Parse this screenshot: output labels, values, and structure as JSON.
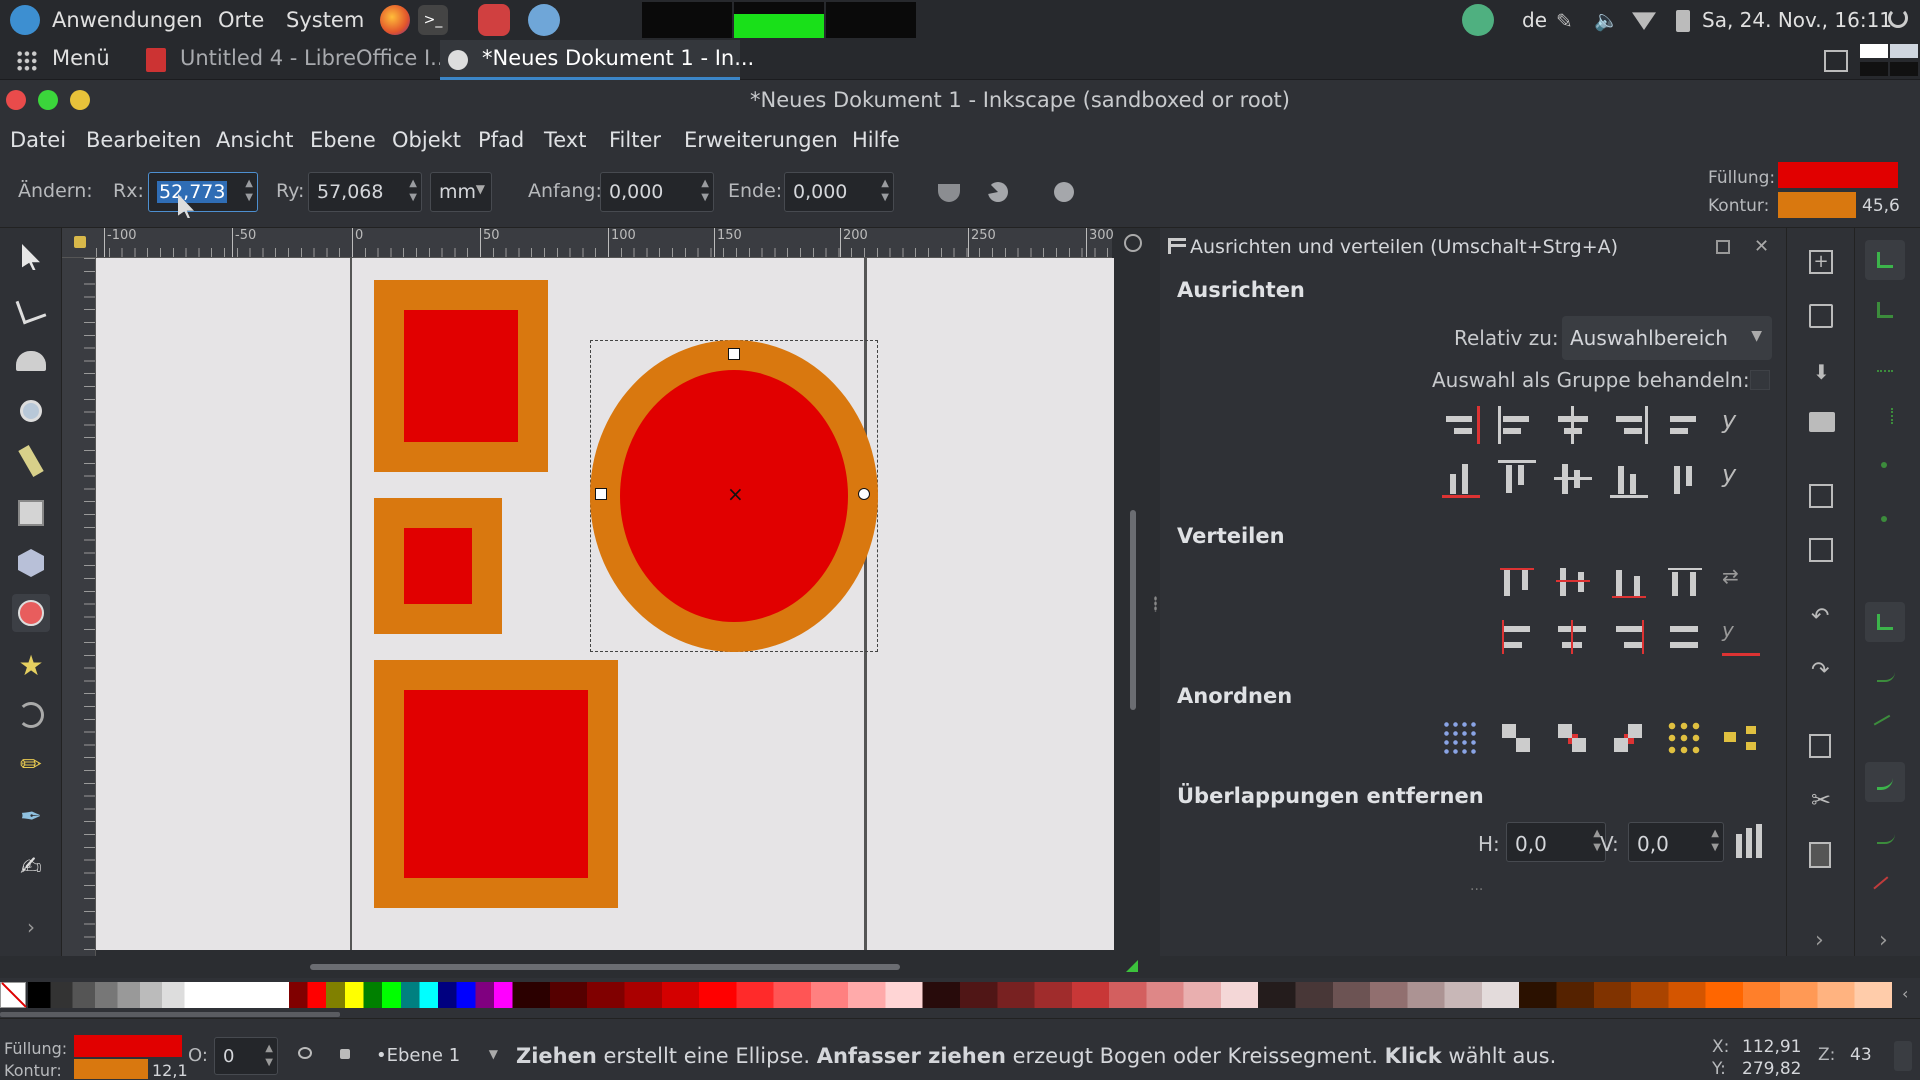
{
  "system_bar": {
    "apps_label": "Anwendungen",
    "places_label": "Orte",
    "system_label": "System",
    "keyboard_layout": "de",
    "datetime": "Sa, 24. Nov., 16:11"
  },
  "taskbar": {
    "menu_label": "Menü",
    "windows": [
      {
        "label": "Untitled 4 - LibreOffice I..."
      },
      {
        "label": "*Neues Dokument 1 - In..."
      }
    ]
  },
  "window": {
    "title": "*Neues Dokument 1 - Inkscape (sandboxed or root)"
  },
  "menu": [
    "Datei",
    "Bearbeiten",
    "Ansicht",
    "Ebene",
    "Objekt",
    "Pfad",
    "Text",
    "Filter",
    "Erweiterungen",
    "Hilfe"
  ],
  "tool_controls": {
    "change_label": "Ändern:",
    "rx_label": "Rx:",
    "rx_value": "52,773",
    "ry_label": "Ry:",
    "ry_value": "57,068",
    "unit": "mm",
    "start_label": "Anfang:",
    "start_value": "0,000",
    "end_label": "Ende:",
    "end_value": "0,000"
  },
  "style_indicator": {
    "fill_label": "Füllung:",
    "stroke_label": "Kontur:",
    "fill_color": "#e10000",
    "stroke_color": "#d9780f",
    "stroke_width": "45,6"
  },
  "ruler_labels": [
    "-100",
    "-50",
    "0",
    "50",
    "100",
    "150",
    "200",
    "250",
    "300"
  ],
  "align_panel": {
    "title": "Ausrichten und verteilen (Umschalt+Strg+A)",
    "align_header": "Ausrichten",
    "relative_label": "Relativ zu:",
    "relative_value": "Auswahlbereich",
    "group_label": "Auswahl als Gruppe behandeln:",
    "distribute_header": "Verteilen",
    "arrange_header": "Anordnen",
    "overlap_header": "Überlappungen entfernen",
    "h_label": "H:",
    "h_value": "0,0",
    "v_label": "V:",
    "v_value": "0,0"
  },
  "status": {
    "fill_label": "Füllung:",
    "stroke_label": "Kontur:",
    "stroke_width": "12,1",
    "opacity_label": "O:",
    "opacity_value": "0",
    "layer": "•Ebene 1",
    "message_bold1": "Ziehen",
    "message_text1": " erstellt eine Ellipse. ",
    "message_bold2": "Anfasser ziehen",
    "message_text2": " erzeugt Bogen oder Kreissegment. ",
    "message_bold3": "Klick",
    "message_text3": " wählt aus.",
    "x_label": "X:",
    "x_value": "112,91",
    "y_label": "Y:",
    "y_value": "279,82",
    "z_label": "Z:",
    "z_value": "43"
  },
  "colors": {
    "shape_fill": "#e10000",
    "shape_stroke": "#d9780f",
    "canvas_bg": "#e6e4e6"
  }
}
